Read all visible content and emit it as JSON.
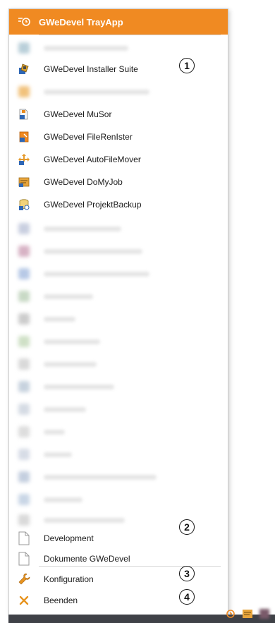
{
  "app": {
    "title": "GWeDevel TrayApp"
  },
  "menu": {
    "blurred_item_1": "",
    "installer": "GWeDevel Installer Suite",
    "blurred_item_2": "",
    "musor": "GWeDevel MuSor",
    "filerenister": "GWeDevel FileRenIster",
    "autofilemover": "GWeDevel AutoFileMover",
    "domyjob": "GWeDevel DoMyJob",
    "projektbackup": "GWeDevel ProjektBackup",
    "development": "Development",
    "dokumente": "Dokumente GWeDevel",
    "konfiguration": "Konfiguration",
    "beenden": "Beenden"
  },
  "callouts": [
    "1",
    "2",
    "3",
    "4"
  ],
  "colors": {
    "accent": "#f08a22",
    "taskbar": "#3f4147"
  }
}
